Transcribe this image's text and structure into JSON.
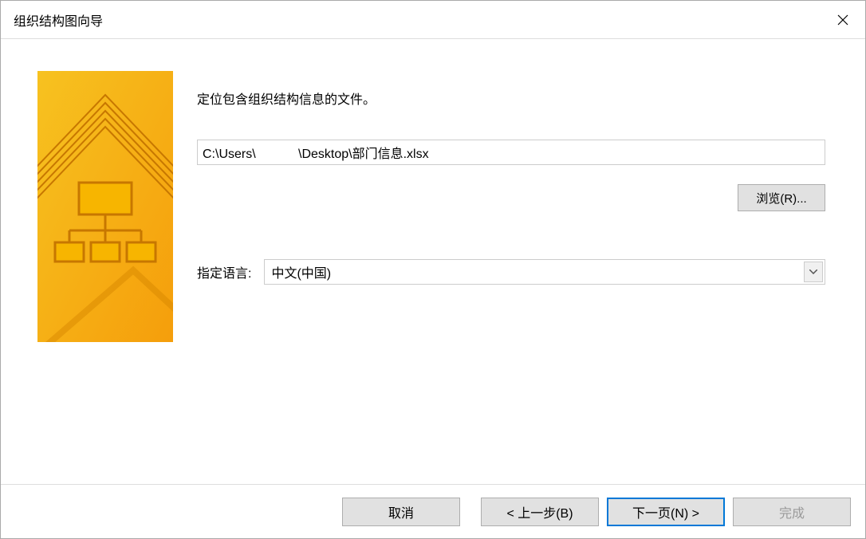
{
  "title": "组织结构图向导",
  "instruction": "定位包含组织结构信息的文件。",
  "path_value": "C:\\Users\\            \\Desktop\\部门信息.xlsx",
  "browse_label": "浏览(R)...",
  "lang_label": "指定语言:",
  "lang_value": "中文(中国)",
  "footer": {
    "cancel": "取消",
    "prev": "< 上一步(B)",
    "next": "下一页(N) >",
    "finish": "完成"
  }
}
